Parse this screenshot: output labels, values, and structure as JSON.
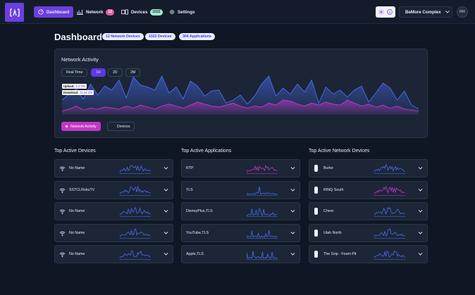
{
  "app": {
    "logo_text": "[^]"
  },
  "nav": {
    "items": [
      {
        "label": "Dashboard",
        "icon": "dashboard-icon"
      },
      {
        "label": "Network",
        "icon": "network-icon",
        "badge": "12"
      },
      {
        "label": "Devices",
        "icon": "devices-icon",
        "badge": "1022"
      },
      {
        "label": "Settings",
        "icon": "gear-icon"
      }
    ],
    "theme_count": "0",
    "site": "BeMore Complex",
    "avatar": "RR"
  },
  "page": {
    "title": "Dashboard",
    "pills": [
      "12 Network Devices",
      "1022 Devices",
      "304 Applications"
    ]
  },
  "activity": {
    "title": "Network Activity",
    "ranges": [
      "Real Time",
      "1H",
      "2D",
      "2M"
    ],
    "active_range": "1H",
    "upload_label": "Upload:",
    "upload_value": "1.2 GB",
    "download_label": "Download:",
    "download_value": "11.56 GB",
    "legend": [
      "Network Activity",
      "Devices"
    ],
    "colors": {
      "download": "#4a6cf0",
      "upload": "#c137c6",
      "accent": "#6b3fe0"
    }
  },
  "chart_data": {
    "type": "area",
    "series": [
      {
        "name": "Network Activity",
        "values": [
          14,
          20,
          25,
          15,
          30,
          19,
          28,
          24,
          34,
          16,
          37,
          29,
          27,
          24,
          38,
          21,
          27,
          15,
          33,
          28,
          18,
          23,
          24,
          11,
          14,
          19,
          10,
          18,
          30,
          38,
          18,
          26,
          20,
          30,
          22,
          34,
          11,
          27,
          20,
          24,
          17,
          24,
          28,
          12,
          21,
          31,
          26,
          14,
          23,
          9,
          5
        ]
      },
      {
        "name": "Devices",
        "values": [
          3,
          5,
          8,
          4,
          6,
          5,
          7,
          6,
          5,
          8,
          6,
          9,
          7,
          5,
          8,
          10,
          8,
          6,
          9,
          12,
          10,
          8,
          7,
          9,
          11,
          8,
          6,
          8,
          7,
          11,
          9,
          14,
          13,
          10,
          8,
          11,
          9,
          12,
          10,
          9,
          14,
          11,
          8,
          10,
          7,
          9,
          6,
          8,
          5,
          4,
          3
        ]
      }
    ],
    "ylim": [
      0,
      45
    ]
  },
  "top_devices": {
    "title": "Top Active Devices",
    "rows": [
      {
        "label": "No Name",
        "icon": "wifi-icon"
      },
      {
        "label": "SSTCLRokuTV",
        "icon": "wifi-icon"
      },
      {
        "label": "No Name",
        "icon": "wifi-icon"
      },
      {
        "label": "No Name",
        "icon": "wifi-icon"
      },
      {
        "label": "No Name",
        "icon": "wifi-icon"
      }
    ]
  },
  "top_apps": {
    "title": "Top Active Applications",
    "rows": [
      {
        "label": "RTP"
      },
      {
        "label": "TLS"
      },
      {
        "label": "DisneyPlus,TLS"
      },
      {
        "label": "YouTube,TLS"
      },
      {
        "label": "Apple,TLS"
      }
    ]
  },
  "top_network": {
    "title": "Top Active Network Devices",
    "rows": [
      {
        "label": "Burke",
        "icon": "access-point-icon"
      },
      {
        "label": "RINQ South",
        "icon": "access-point-icon"
      },
      {
        "label": "Cheer",
        "icon": "access-point-icon"
      },
      {
        "label": "Utah North",
        "icon": "access-point-icon"
      },
      {
        "label": "The Grip - Foam Pit",
        "icon": "access-point-icon"
      }
    ]
  }
}
